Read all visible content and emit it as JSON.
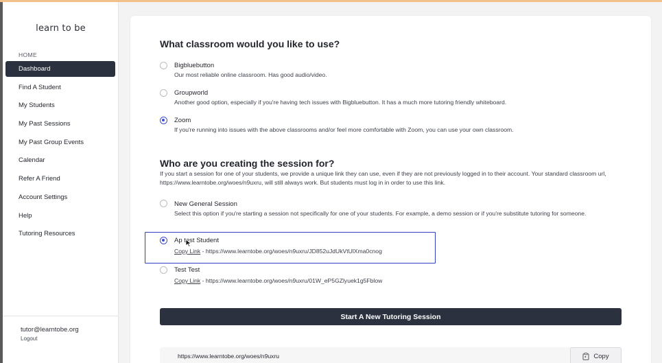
{
  "sidebar": {
    "logo": "learn to be",
    "home_label": "HOME",
    "items": [
      {
        "label": "Dashboard",
        "active": true
      },
      {
        "label": "Find A Student"
      },
      {
        "label": "My Students"
      },
      {
        "label": "My Past Sessions"
      },
      {
        "label": "My Past Group Events"
      },
      {
        "label": "Calendar"
      },
      {
        "label": "Refer A Friend"
      },
      {
        "label": "Account Settings"
      },
      {
        "label": "Help"
      },
      {
        "label": "Tutoring Resources"
      }
    ],
    "user_email": "tutor@learntobe.org",
    "logout": "Logout"
  },
  "classroom": {
    "heading": "What classroom would you like to use?",
    "options": [
      {
        "title": "Bigbluebutton",
        "desc": "Our most reliable online classroom. Has good audio/video.",
        "selected": false
      },
      {
        "title": "Groupworld",
        "desc": "Another good option, especially if you're having tech issues with Bigbluebutton. It has a much more tutoring friendly whiteboard.",
        "selected": false
      },
      {
        "title": "Zoom",
        "desc": "If you're running into issues with the above classrooms and/or feel more comfortable with Zoom, you can use your own classroom.",
        "selected": true
      }
    ]
  },
  "session_for": {
    "heading": "Who are you creating the session for?",
    "desc": "If you start a session for one of your students, we provide a unique link they can use, even if they are not previously logged in to their account. Your standard classroom url, https://www.learntobe.org/woes/n9uxru, will still always work. But students must log in in order to use this link.",
    "options": [
      {
        "title": "New General Session",
        "desc": "Select this option if you're starting a session not specifically for one of your students. For example, a demo session or if you're substitute tutoring for someone.",
        "selected": false
      },
      {
        "title": "Ap test Student",
        "copy_label": "Copy Link",
        "link": " - https://www.learntobe.org/woes/n9uxru/JD852uJdUkVtUlXma0cnog",
        "selected": true
      },
      {
        "title": "Test Test",
        "copy_label": "Copy Link",
        "link": " - https://www.learntobe.org/woes/n9uxru/01W_eP5GZlyuek1g5Fblow",
        "selected": false
      }
    ]
  },
  "start_button": "Start A New Tutoring Session",
  "url_bar": {
    "url": "https://www.learntobe.org/woes/n9uxru",
    "copy_label": "Copy"
  },
  "colors": {
    "accent": "#3f4bd2",
    "dark": "#2b313e",
    "highlight": "#2f3fc5"
  }
}
